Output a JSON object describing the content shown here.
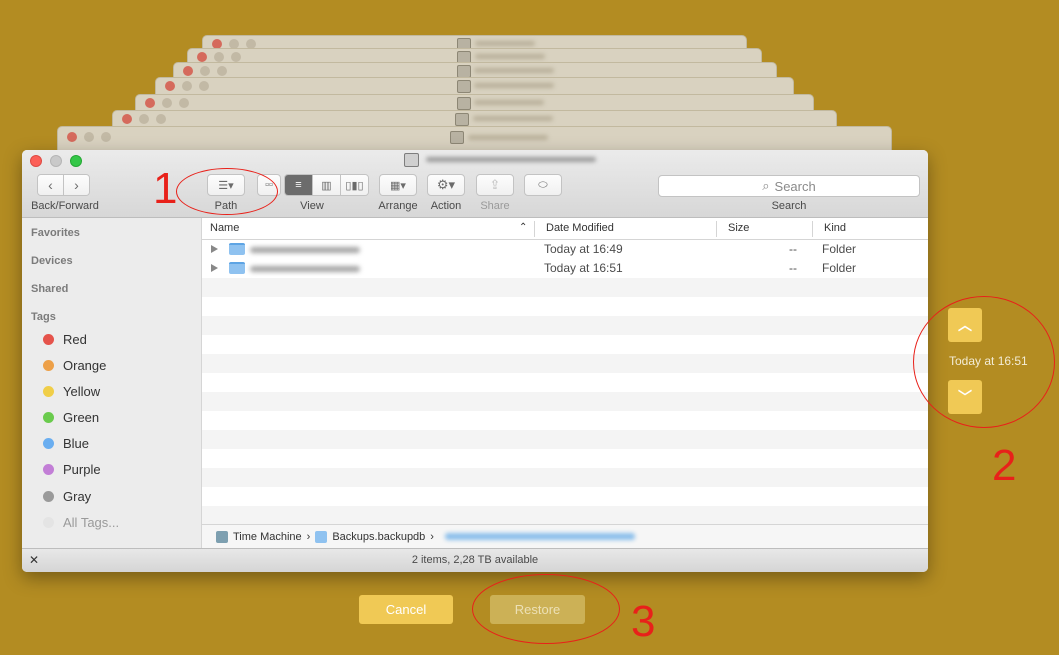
{
  "window": {
    "toolbar": {
      "back_forward_label": "Back/Forward",
      "path_label": "Path",
      "view_label": "View",
      "arrange_label": "Arrange",
      "action_label": "Action",
      "share_label": "Share",
      "search_label": "Search",
      "search_placeholder": "Search"
    },
    "sidebar": {
      "favorites": "Favorites",
      "devices": "Devices",
      "shared": "Shared",
      "tags_header": "Tags",
      "tags": [
        {
          "label": "Red",
          "color": "#e5534b"
        },
        {
          "label": "Orange",
          "color": "#eda048"
        },
        {
          "label": "Yellow",
          "color": "#f0ce48"
        },
        {
          "label": "Green",
          "color": "#6acb4d"
        },
        {
          "label": "Blue",
          "color": "#6aaef0"
        },
        {
          "label": "Purple",
          "color": "#c27ed6"
        },
        {
          "label": "Gray",
          "color": "#9a9a9a"
        },
        {
          "label": "All Tags...",
          "color": "#e4e4e4"
        }
      ]
    },
    "columns": {
      "name": "Name",
      "date_modified": "Date Modified",
      "size": "Size",
      "kind": "Kind"
    },
    "files": [
      {
        "date": "Today at 16:49",
        "size": "--",
        "kind": "Folder"
      },
      {
        "date": "Today at 16:51",
        "size": "--",
        "kind": "Folder"
      }
    ],
    "pathbar": {
      "segment1": "Time Machine",
      "segment2": "Backups.backupdb"
    },
    "status": "2 items, 2,28 TB available"
  },
  "timeline": {
    "current_date": "Today at 16:51"
  },
  "buttons": {
    "cancel": "Cancel",
    "restore": "Restore"
  },
  "annotations": {
    "n1": "1",
    "n2": "2",
    "n3": "3",
    "color": "#e8211a"
  }
}
